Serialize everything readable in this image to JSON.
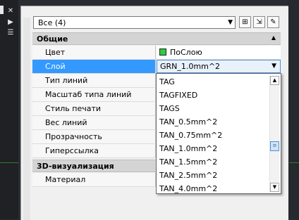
{
  "left_strip": {
    "close_glyph": "✕",
    "expand_glyph": "▶",
    "menu_glyph": "☰"
  },
  "selector": {
    "value": "Все (4)",
    "arrow_glyph": "▼"
  },
  "toolbar": {
    "toggle_glyph": "⊞",
    "select_glyph": "⇲",
    "filter_glyph": "✎"
  },
  "sections": [
    {
      "label": "Общие",
      "collapse_glyph": "▲"
    },
    {
      "label": "3D-визуализация"
    }
  ],
  "general_rows": [
    {
      "name": "Цвет",
      "value": "ПоСлою"
    },
    {
      "name": "Слой",
      "value": "GRN_1.0mm^2"
    },
    {
      "name": "Тип линий",
      "value": ""
    },
    {
      "name": "Масштаб типа линий",
      "value": ""
    },
    {
      "name": "Стиль печати",
      "value": ""
    },
    {
      "name": "Вес линий",
      "value": ""
    },
    {
      "name": "Прозрачность",
      "value": ""
    },
    {
      "name": "Гиперссылка",
      "value": ""
    }
  ],
  "viz_rows": [
    {
      "name": "Материал",
      "value": ""
    }
  ],
  "layer_dropdown": {
    "arrow_glyph": "▼",
    "items": [
      "TAG",
      "TAGFIXED",
      "TAGS",
      "TAN_0.5mm^2",
      "TAN_0.75mm^2",
      "TAN_1.0mm^2",
      "TAN_1.5mm^2",
      "TAN_2.5mm^2",
      "TAN_4.0mm^2"
    ],
    "scroll": {
      "up_glyph": "▲",
      "down_glyph": "▼",
      "thumb_glyph": "≡",
      "position": 0.55
    }
  },
  "colors": {
    "accent": "#3399ff",
    "swatch": "#2ecc40"
  }
}
